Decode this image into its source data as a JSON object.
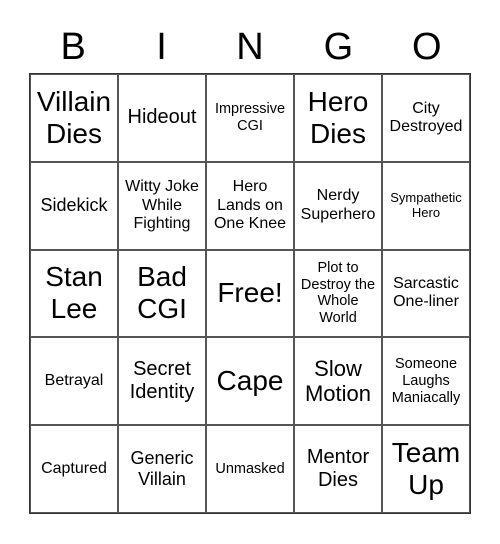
{
  "header": {
    "letters": [
      "B",
      "I",
      "N",
      "G",
      "O"
    ]
  },
  "card": {
    "cells": [
      "Villain Dies",
      "Hideout",
      "Impressive CGI",
      "Hero Dies",
      "City Destroyed",
      "Sidekick",
      "Witty Joke While Fighting",
      "Hero Lands on One Knee",
      "Nerdy Superhero",
      "Sympathetic Hero",
      "Stan Lee",
      "Bad CGI",
      "Free!",
      "Plot to Destroy the Whole World",
      "Sarcastic One-liner",
      "Betrayal",
      "Secret Identity",
      "Cape",
      "Slow Motion",
      "Someone Laughs Maniacally",
      "Captured",
      "Generic Villain",
      "Unmasked",
      "Mentor Dies",
      "Team Up"
    ]
  }
}
